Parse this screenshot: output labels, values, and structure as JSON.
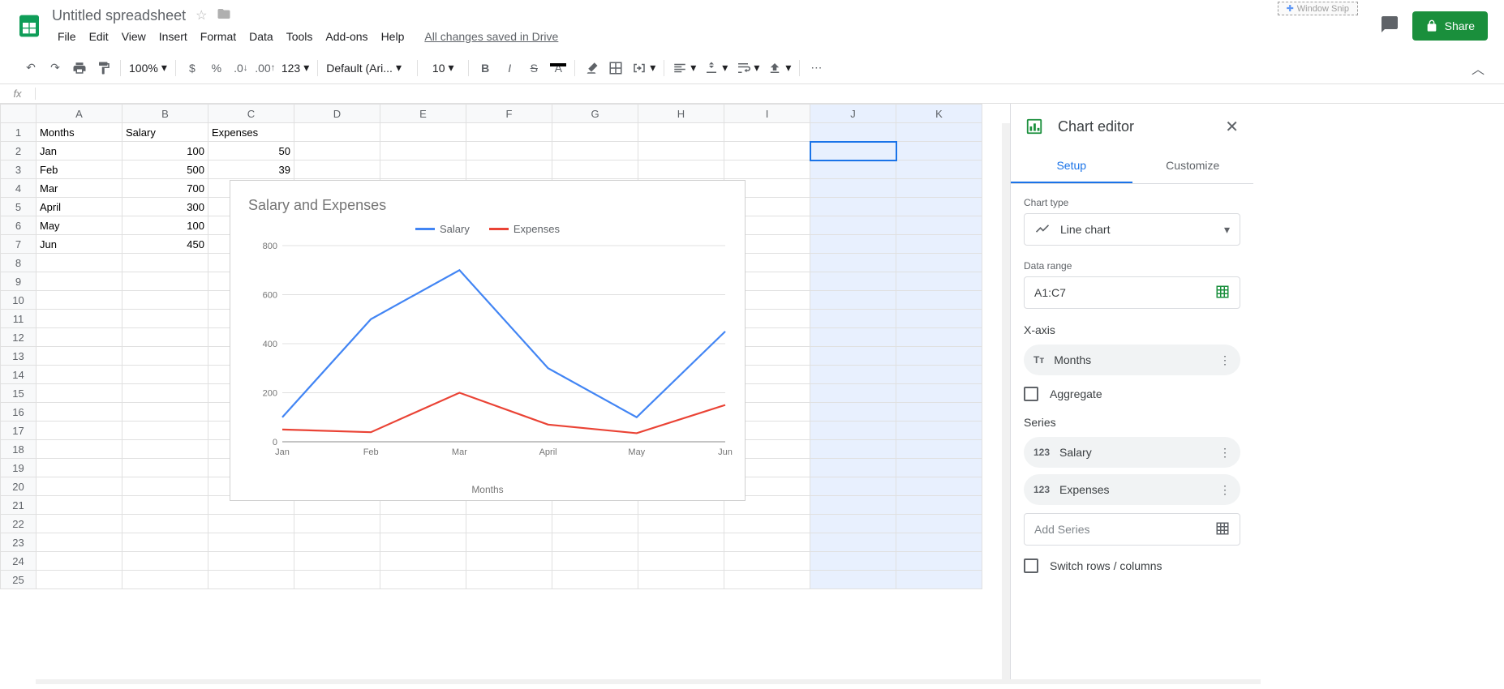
{
  "doc_title": "Untitled spreadsheet",
  "menus": [
    "File",
    "Edit",
    "View",
    "Insert",
    "Format",
    "Data",
    "Tools",
    "Add-ons",
    "Help"
  ],
  "drive_status": "All changes saved in Drive",
  "share_label": "Share",
  "window_snip": "Window Snip",
  "toolbar": {
    "zoom": "100%",
    "font": "Default (Ari...",
    "font_size": "10",
    "more_formats": "123"
  },
  "spreadsheet": {
    "columns": [
      "A",
      "B",
      "C",
      "D",
      "E",
      "F",
      "G",
      "H",
      "I",
      "J",
      "K"
    ],
    "rows": 25,
    "headers": [
      "Months",
      "Salary",
      "Expenses"
    ],
    "data": [
      [
        "Jan",
        100,
        50
      ],
      [
        "Feb",
        500,
        39
      ],
      [
        "Mar",
        700,
        null
      ],
      [
        "April",
        300,
        null
      ],
      [
        "May",
        100,
        null
      ],
      [
        "Jun",
        450,
        null
      ]
    ],
    "selected_cell": "J2",
    "selected_cols": [
      "J",
      "K"
    ]
  },
  "chart_data": {
    "type": "line",
    "title": "Salary and Expenses",
    "xlabel": "Months",
    "ylabel": "",
    "categories": [
      "Jan",
      "Feb",
      "Mar",
      "April",
      "May",
      "Jun"
    ],
    "series": [
      {
        "name": "Salary",
        "color": "#4285f4",
        "values": [
          100,
          500,
          700,
          300,
          100,
          450
        ]
      },
      {
        "name": "Expenses",
        "color": "#ea4335",
        "values": [
          50,
          39,
          200,
          70,
          35,
          150
        ]
      }
    ],
    "ylim": [
      0,
      800
    ],
    "yticks": [
      0,
      200,
      400,
      600,
      800
    ]
  },
  "sidebar": {
    "title": "Chart editor",
    "tabs": {
      "setup": "Setup",
      "customize": "Customize"
    },
    "chart_type_label": "Chart type",
    "chart_type_value": "Line chart",
    "data_range_label": "Data range",
    "data_range_value": "A1:C7",
    "xaxis_label": "X-axis",
    "xaxis_value": "Months",
    "aggregate_label": "Aggregate",
    "series_label": "Series",
    "series_items": [
      "Salary",
      "Expenses"
    ],
    "add_series": "Add Series",
    "switch_label": "Switch rows / columns"
  }
}
